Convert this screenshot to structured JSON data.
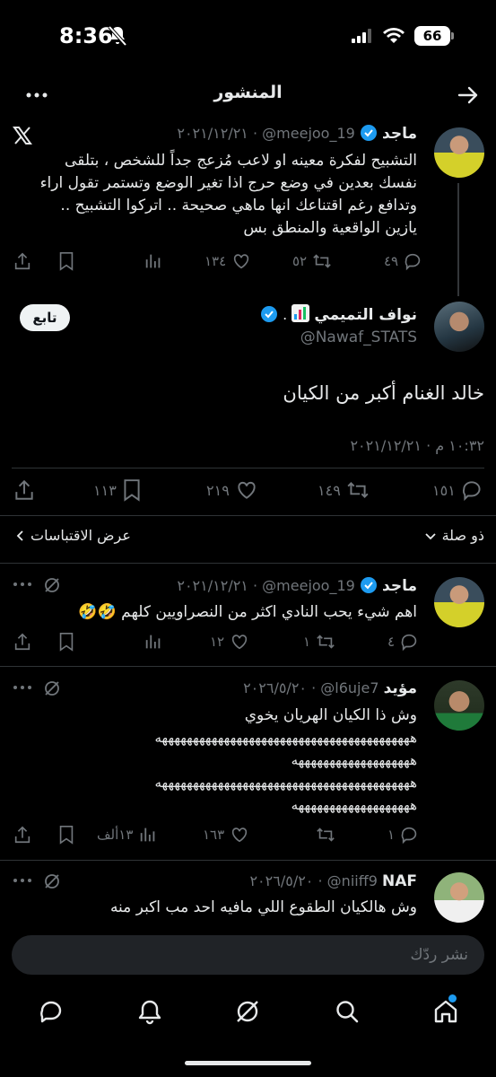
{
  "status_bar": {
    "time": "8:36",
    "battery": "66"
  },
  "header": {
    "title": "المنشور"
  },
  "quoted_tweet": {
    "name": "ماجد",
    "handle": "@meejoo_19",
    "date": "٢٠٢١/١٢/٢١",
    "lines": [
      "التشبيح لفكرة معينه او لاعب مُزعج جداً للشخص ، بتلقى",
      "نفسك بعدين في وضع حرج اذا تغير الوضع وتستمر تقول اراء",
      "وتدافع رغم اقتناعك انها ماهي صحيحة .. اتركوا التشبيح ..",
      "يازين الواقعية والمنطق بس"
    ],
    "replies": "٤٩",
    "retweets": "٥٢",
    "likes": "١٣٤"
  },
  "main_tweet": {
    "name": "نواف التميمي",
    "handle": "@Nawaf_STATS",
    "follow_label": "تابع",
    "text": "خالد الغنام أكبر من الكيان",
    "timestamp": "١٠:٣٢ م · ٢٠٢١/١٢/٢١",
    "replies": "١٥١",
    "retweets": "١٤٩",
    "likes": "٢١٩",
    "bookmarks": "١١٣"
  },
  "sort_bar": {
    "relevance_label": "ذو صلة",
    "quotes_label": "عرض الاقتباسات"
  },
  "replies": [
    {
      "name": "ماجد",
      "handle": "@meejoo_19",
      "date": "٢٠٢١/١٢/٢١",
      "text": "اهم شيء يحب النادي اكثر من النصراويين كلهم 🤣🤣",
      "replies": "٤",
      "retweets": "١",
      "likes": "١٢"
    },
    {
      "name": "مؤيد",
      "handle": "@l6uje7",
      "date": "٢٠٢٦/٥/٢٠",
      "line1": "وش ذا الكيان الهريان يخوي",
      "line2": "هههههههههههههههههههههههههههههههههههههههههه",
      "line3": "هههههههههههههههههههه",
      "line4": "هههههههههههههههههههههههههههههههههههههههههه",
      "line5": "هههههههههههههههههههه",
      "replies": "١",
      "likes": "١٦٣",
      "views": "١٣ألف"
    },
    {
      "name": "NAF",
      "handle": "@niiff9",
      "date": "٢٠٢٦/٥/٢٠",
      "text": "وش هالكيان الطقوع اللي مافيه احد مب اكبر منه"
    }
  ],
  "composer": {
    "placeholder": "نشر ردّك"
  },
  "colors": {
    "accent": "#1d9bf0",
    "background": "#000000",
    "muted": "#71767b",
    "divider": "#2f3336"
  },
  "icons": [
    "signal-icon",
    "wifi-icon",
    "mute-bell-icon",
    "more-icon",
    "back-arrow-icon",
    "x-logo-icon",
    "reply-icon",
    "retweet-icon",
    "like-icon",
    "views-icon",
    "bookmark-icon",
    "share-icon",
    "verified-icon",
    "grok-icon",
    "chevron-down-icon",
    "chevron-left-icon",
    "home-icon",
    "search-icon",
    "messages-icon",
    "bell-icon"
  ]
}
